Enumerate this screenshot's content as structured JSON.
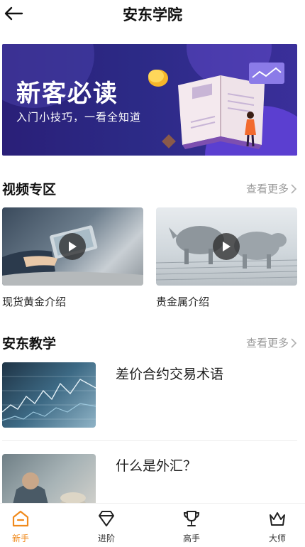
{
  "header": {
    "title": "安东学院"
  },
  "banner": {
    "title": "新客必读",
    "subtitle": "入门小技巧，一看全知道"
  },
  "video_section": {
    "title": "视频专区",
    "more": "查看更多",
    "items": [
      {
        "label": "现货黄金介绍"
      },
      {
        "label": "贵金属介绍"
      }
    ]
  },
  "teach_section": {
    "title": "安东教学",
    "more": "查看更多",
    "items": [
      {
        "title": "差价合约交易术语"
      },
      {
        "title": "什么是外汇？"
      }
    ]
  },
  "tabbar": {
    "active_color": "#f08a1c",
    "items": [
      {
        "label": "新手",
        "icon": "home-icon"
      },
      {
        "label": "进阶",
        "icon": "diamond-icon"
      },
      {
        "label": "高手",
        "icon": "trophy-icon"
      },
      {
        "label": "大师",
        "icon": "crown-icon"
      }
    ]
  }
}
